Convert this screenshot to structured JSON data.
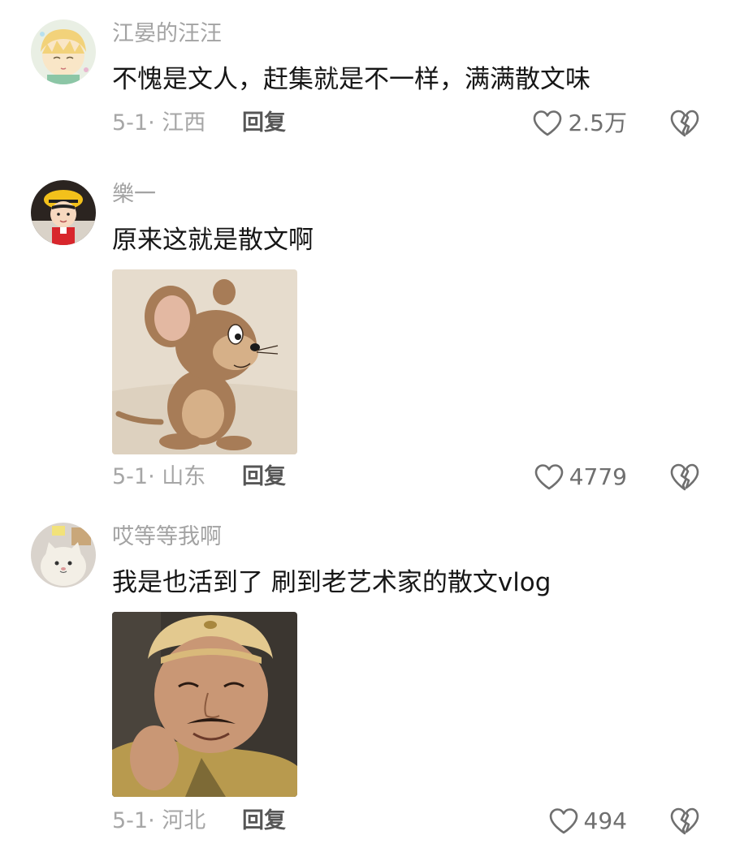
{
  "comments": [
    {
      "username": "江晏的汪汪",
      "text": "不愧是文人，赶集就是不一样，满满散文味",
      "date": "5-1",
      "location": "江西",
      "reply_label": "回复",
      "likes": "2.5万",
      "avatar_icon": "anime-boy-avatar"
    },
    {
      "username": "樂一",
      "text": "原来这就是散文啊",
      "date": "5-1",
      "location": "山东",
      "reply_label": "回复",
      "likes": "4779",
      "avatar_icon": "yellow-hat-girl-avatar",
      "image_icon": "cartoon-mouse-sticker"
    },
    {
      "username": "哎等等我啊",
      "text": "我是也活到了  刷到老艺术家的散文vlog",
      "date": "5-1",
      "location": "河北",
      "reply_label": "回复",
      "likes": "494",
      "avatar_icon": "plush-cat-avatar",
      "image_icon": "smiling-man-meme"
    }
  ],
  "colors": {
    "username": "#a3a3a3",
    "text": "#161616",
    "meta": "#a6a6a6",
    "reply": "#565656",
    "icon": "#6f6f6f"
  }
}
